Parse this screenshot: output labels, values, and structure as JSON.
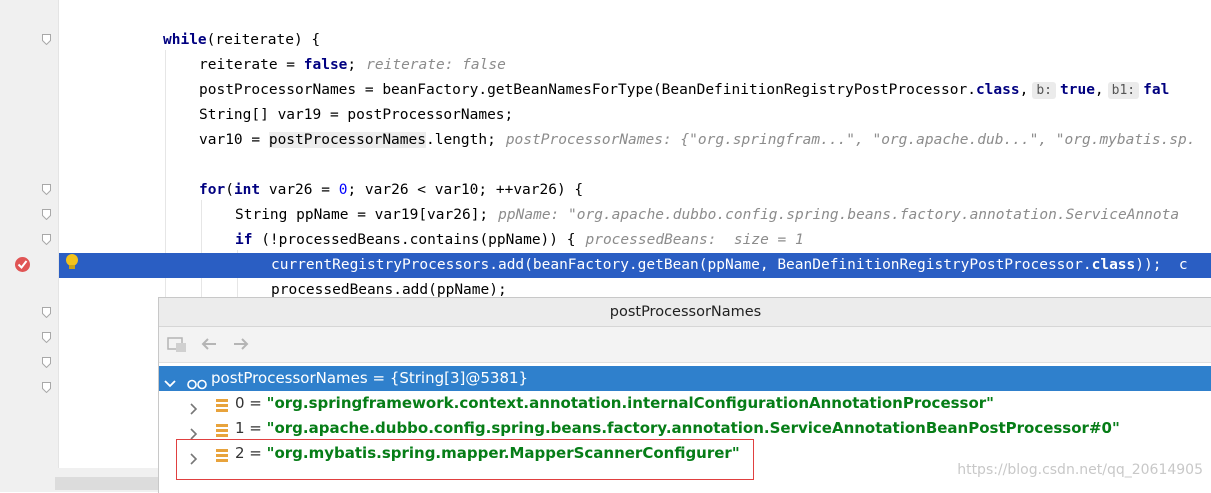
{
  "editor": {
    "lines": [
      {
        "parts": [
          {
            "t": "while",
            "c": "kw"
          },
          {
            "t": "(reiterate) {"
          }
        ]
      },
      {
        "parts": [
          {
            "t": "reiterate = "
          },
          {
            "t": "false",
            "c": "kw"
          },
          {
            "t": ";"
          },
          {
            "t": "reiterate: false",
            "c": "hint"
          }
        ]
      },
      {
        "parts": [
          {
            "t": "postProcessorNames = beanFactory.getBeanNamesForType(BeanDefinitionRegistryPostProcessor."
          },
          {
            "t": "class",
            "c": "kw"
          },
          {
            "t": ","
          },
          {
            "t": "b:",
            "c": "param"
          },
          {
            "t": "true",
            "c": "kw"
          },
          {
            "t": ","
          },
          {
            "t": "b1:",
            "c": "param"
          },
          {
            "t": "fal",
            "c": "kw"
          }
        ]
      },
      {
        "parts": [
          {
            "t": "String[] var19 = postProcessorNames;"
          }
        ]
      },
      {
        "parts": [
          {
            "t": "var10 = "
          },
          {
            "t": "postProcessorNames",
            "c": "hl"
          },
          {
            "t": ".length;"
          },
          {
            "t": "postProcessorNames: {\"org.springfram...\", \"org.apache.dub...\", \"org.mybatis.sp.",
            "c": "hint"
          }
        ]
      },
      {
        "parts": [
          {
            "t": ""
          }
        ]
      },
      {
        "parts": [
          {
            "t": "for",
            "c": "kw"
          },
          {
            "t": "("
          },
          {
            "t": "int",
            "c": "kw"
          },
          {
            "t": " var26 = "
          },
          {
            "t": "0",
            "c": "num"
          },
          {
            "t": "; var26 < var10; ++var26) {"
          }
        ]
      },
      {
        "parts": [
          {
            "t": "String ppName = var19[var26];"
          },
          {
            "t": "ppName: \"org.apache.dubbo.config.spring.beans.factory.annotation.ServiceAnnota",
            "c": "hint"
          }
        ]
      },
      {
        "parts": [
          {
            "t": "if",
            "c": "kw"
          },
          {
            "t": " (!processedBeans.contains(ppName)) {"
          },
          {
            "t": "processedBeans:  size = 1",
            "c": "hint"
          }
        ]
      },
      {
        "parts": [
          {
            "t": "currentRegistryProcessors.add(beanFactory.getBean(ppName, BeanDefinitionRegistryPostProcessor."
          },
          {
            "t": "class",
            "c": "kw"
          },
          {
            "t": "));  c"
          }
        ]
      },
      {
        "parts": [
          {
            "t": "processedBeans.add(ppName);"
          }
        ]
      }
    ]
  },
  "popup": {
    "title": "postProcessorNames",
    "root": "postProcessorNames = {String[3]@5381}",
    "items": [
      {
        "index": "0 = ",
        "value": "\"org.springframework.context.annotation.internalConfigurationAnnotationProcessor\""
      },
      {
        "index": "1 = ",
        "value": "\"org.apache.dubbo.config.spring.beans.factory.annotation.ServiceAnnotationBeanPostProcessor#0\""
      },
      {
        "index": "2 = ",
        "value": "\"org.mybatis.spring.mapper.MapperScannerConfigurer\""
      }
    ]
  },
  "watermark": "https://blog.csdn.net/qq_20614905",
  "colors": {
    "execution_line": "#2a5ec3",
    "selected_row": "#2f80cc",
    "string_value": "#067d17",
    "highlight_box": "#e04040"
  }
}
